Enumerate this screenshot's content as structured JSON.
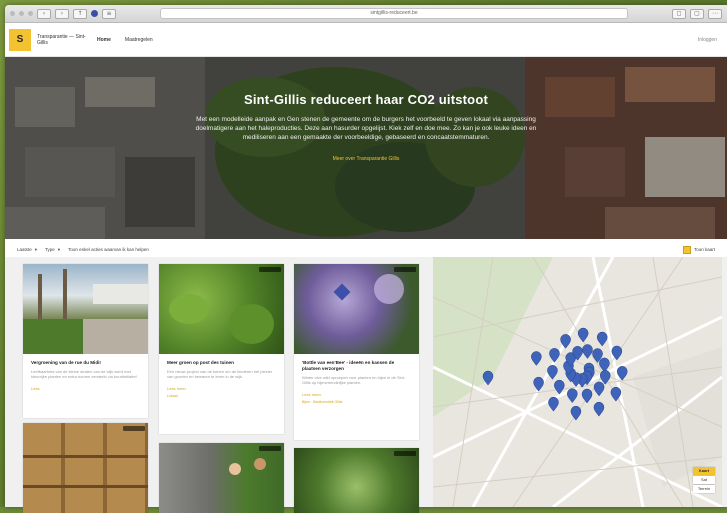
{
  "browser": {
    "url": "sintgillis-reduceert.be"
  },
  "site": {
    "logo_letter": "S",
    "brand": "Transparantie — Sint-Gillis",
    "nav": [
      "Home",
      "Maatregelen"
    ],
    "login": "Inloggen"
  },
  "hero": {
    "title": "Sint-Gillis reduceert haar CO2 uitstoot",
    "body": "Met een modelleide aanpak en Gen stenen de gemeente om de burgers het voorbeeld te geven lokaal via aanpassing doelmatigere aan het haleproducties. Deze aan hasurder opgelijst. Kiek zelf en doe mee. Zo kan je ook leuke ideen en mediliseren aan een gemaakte der voorbeeldige, gebaseerd en concaatstemmaturen.",
    "link": "Meer over Transparantie Gillis"
  },
  "filters": {
    "sort": "Laatste",
    "type": "Type",
    "text": "Toon enkel acties waarvan ik kan helpen",
    "toggle_label": "Toon kaart"
  },
  "cards": [
    {
      "title": "Vergroening van de rue du Midi!",
      "body": "Leefbaarheid van de kleine straten van de wijk werd met kleurrijke planten en extra bomen versterkt via buurtinitiatief.",
      "more": "Lees",
      "meta": ""
    },
    {
      "title": "Meer groen op post des tuinen",
      "body": "Een nieuw project van de tuinen om de kinderen het plezier van groeien en bewaren te leren in de wijk.",
      "more": "Lees meer",
      "meta": "Lokaal"
    },
    {
      "title": "'Bottle van een'Bee' - ideeën en kansen de plaatsen verzorgen",
      "body": "Winter vive wild oproepen voor planten en bijen in de Sint-Gillis op bijenvriendelijke planten.",
      "more": "Lees meer",
      "meta": "Bijen · Biodiversiteit Gillis"
    },
    {
      "title": "",
      "body": "",
      "more": "",
      "meta": ""
    },
    {
      "title": "",
      "body": "",
      "more": "",
      "meta": ""
    },
    {
      "title": "",
      "body": "",
      "more": "",
      "meta": ""
    }
  ],
  "map": {
    "controls": [
      "Kaart",
      "Sat",
      "Terrein"
    ]
  },
  "colors": {
    "accent": "#f2c230",
    "marker": "#3f63b8"
  }
}
